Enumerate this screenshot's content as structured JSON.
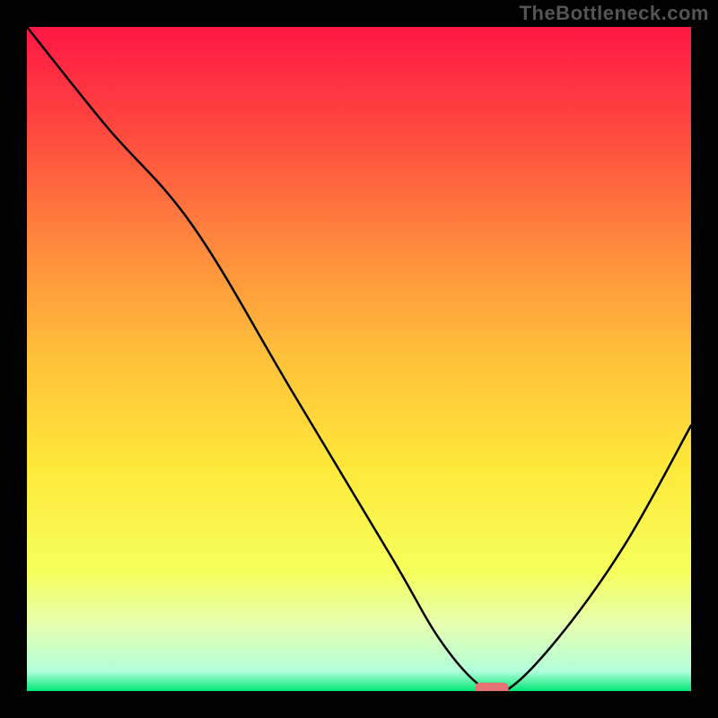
{
  "watermark": {
    "text": "TheBottleneck.com"
  },
  "chart_data": {
    "type": "line",
    "title": "",
    "xlabel": "",
    "ylabel": "",
    "xlim": [
      0,
      100
    ],
    "ylim": [
      0,
      100
    ],
    "grid": false,
    "legend": false,
    "background_gradient": {
      "stops": [
        {
          "offset": 0,
          "color": "#ff1744"
        },
        {
          "offset": 0.16,
          "color": "#ff4a3f"
        },
        {
          "offset": 0.33,
          "color": "#ff8a3d"
        },
        {
          "offset": 0.5,
          "color": "#ffc13a"
        },
        {
          "offset": 0.66,
          "color": "#ffe83a"
        },
        {
          "offset": 0.82,
          "color": "#f6ff5c"
        },
        {
          "offset": 0.9,
          "color": "#e6ffb0"
        },
        {
          "offset": 0.97,
          "color": "#b2ffda"
        },
        {
          "offset": 1,
          "color": "#00e676"
        }
      ]
    },
    "series": [
      {
        "name": "bottleneck-curve",
        "x": [
          0,
          12,
          25,
          40,
          55,
          62,
          68,
          72,
          80,
          90,
          100
        ],
        "y": [
          100,
          85,
          70,
          45,
          20,
          8,
          1,
          0,
          8,
          22,
          40
        ]
      }
    ],
    "marker": {
      "name": "selected-point",
      "x": 70,
      "y": 0,
      "color": "#e57373",
      "width": 5,
      "height": 2
    }
  }
}
